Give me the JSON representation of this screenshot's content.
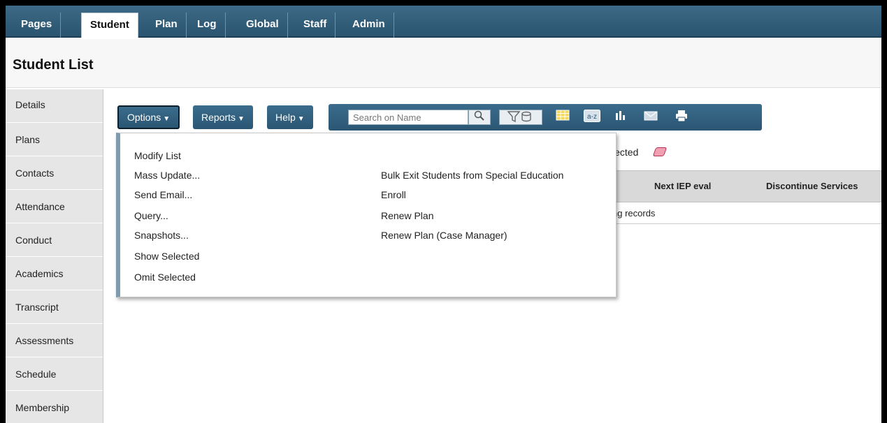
{
  "tabs": [
    "Pages",
    "Student",
    "Plan",
    "Log",
    "Global",
    "Staff",
    "Admin"
  ],
  "active_tab": "Student",
  "page_title": "Student List",
  "sidebar": [
    "Details",
    "Plans",
    "Contacts",
    "Attendance",
    "Conduct",
    "Academics",
    "Transcript",
    "Assessments",
    "Schedule",
    "Membership"
  ],
  "toolbar": {
    "options_label": "Options",
    "reports_label": "Reports",
    "help_label": "Help",
    "search_placeholder": "Search on Name",
    "icons": [
      "search-icon",
      "filter-icon",
      "grid-icon",
      "sort-az-icon",
      "chart-icon",
      "email-icon",
      "print-icon"
    ]
  },
  "options_menu": {
    "left": [
      "Modify List",
      "Mass Update...",
      "Send Email...",
      "Query...",
      "Snapshots...",
      "Show Selected",
      "Omit Selected"
    ],
    "right": [
      "Bulk Exit Students from Special Education",
      "Enroll",
      "Renew Plan",
      "Renew Plan (Case Manager)"
    ]
  },
  "selection_text": "lected",
  "table": {
    "columns": [
      "Next IEP eval",
      "Discontinue Services"
    ],
    "status": "ng records"
  },
  "colors": {
    "toolbar": "#2f5d7a",
    "menu_border": "#7f9bb0"
  }
}
